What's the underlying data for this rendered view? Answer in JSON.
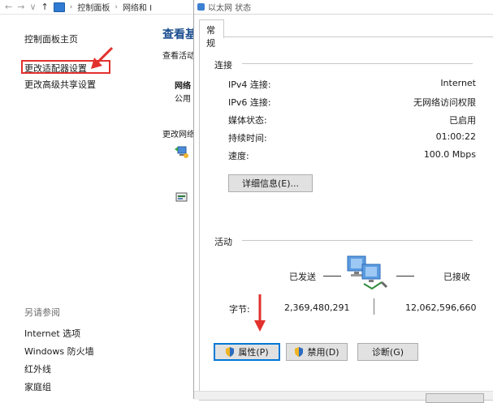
{
  "breadcrumb": {
    "back": "←",
    "forward": "→",
    "recent": "∨",
    "up": "↑",
    "items": [
      "控制面板",
      "网络和 I"
    ]
  },
  "sidebar": {
    "home": "控制面板主页",
    "change_adapter": "更改适配器设置",
    "change_sharing": "更改高级共享设置",
    "see_also_title": "另请参阅",
    "see_also": [
      "Internet 选项",
      "Windows 防火墙",
      "红外线",
      "家庭组"
    ]
  },
  "main": {
    "title": "查看基",
    "view_active": "查看活动",
    "network_name": "网络",
    "network_type": "公用",
    "change_network": "更改网络"
  },
  "dialog": {
    "title": "以太网 状态",
    "tab": "常规",
    "connection": {
      "label": "连接",
      "rows": [
        {
          "label": "IPv4 连接:",
          "value": "Internet"
        },
        {
          "label": "IPv6 连接:",
          "value": "无网络访问权限"
        },
        {
          "label": "媒体状态:",
          "value": "已启用"
        },
        {
          "label": "持续时间:",
          "value": "01:00:22"
        },
        {
          "label": "速度:",
          "value": "100.0 Mbps"
        }
      ],
      "details_button": "详细信息(E)..."
    },
    "activity": {
      "label": "活动",
      "sent_label": "已发送",
      "received_label": "已接收",
      "bytes_label": "字节:",
      "bytes_sent": "2,369,480,291",
      "bytes_received": "12,062,596,660"
    },
    "buttons": {
      "properties": "属性(P)",
      "disable": "禁用(D)",
      "diagnose": "诊断(G)"
    }
  },
  "colors": {
    "annotation_red": "#e2312d",
    "link_blue": "#0b4fa3",
    "accent_blue": "#0078d7"
  }
}
